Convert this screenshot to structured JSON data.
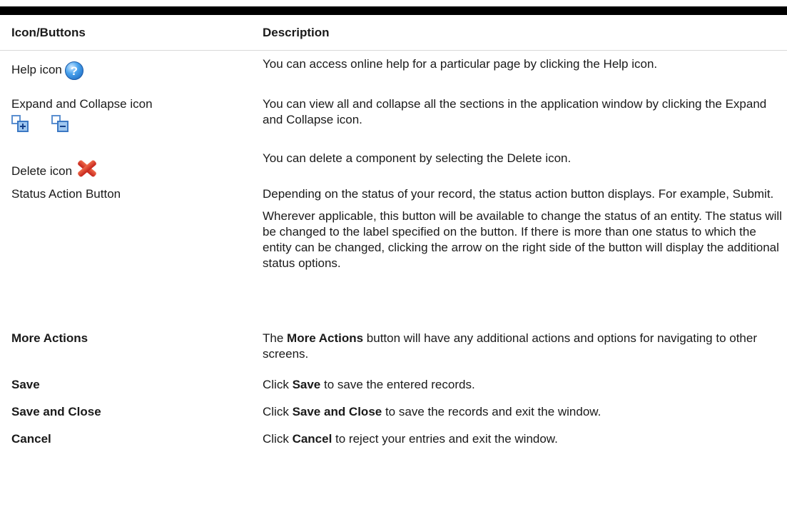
{
  "table": {
    "headers": [
      "Icon/Buttons",
      "Description"
    ],
    "rows": [
      {
        "name": "Help icon",
        "icon": "help-icon",
        "description": "You can access online help for a particular page by clicking the Help icon."
      },
      {
        "name": "Expand and Collapse icon",
        "icons": [
          "expand-icon",
          "collapse-icon"
        ],
        "description": "You can view all and collapse all the sections in the application window by clicking the Expand and Collapse icon."
      },
      {
        "name": "Delete icon",
        "icon": "delete-icon",
        "description": "You can delete a component by selecting the Delete icon."
      },
      {
        "name": "Status Action Button",
        "description": "Depending on the status of your record, the status action button displays. For example, Submit.",
        "description_2": "Wherever applicable, this button will be available to change the status of an entity. The status will be changed to the label specified on the button. If there is more than one status to which the entity can be changed, clicking the arrow on the right side of the button will display the additional status options."
      },
      {
        "name": "More Actions",
        "desc_pre": "The ",
        "desc_bold": "More Actions",
        "desc_post": " button will have any additional actions and options for navigating to other screens."
      },
      {
        "name": "Save",
        "desc_pre": "Click ",
        "desc_bold": "Save",
        "desc_post": " to save the entered records."
      },
      {
        "name": "Save and Close",
        "desc_pre": "Click ",
        "desc_bold": "Save and Close",
        "desc_post": " to save the records and exit the window."
      },
      {
        "name": "Cancel",
        "desc_pre": "Click ",
        "desc_bold": "Cancel",
        "desc_post": " to reject your entries and exit the window."
      }
    ]
  },
  "help_icon_glyph": "?",
  "colors": {
    "help_icon": "#2e86de",
    "expand_collapse_icon": "#5b8fd0",
    "delete_icon": "#d9342b",
    "top_rule": "#000000"
  }
}
